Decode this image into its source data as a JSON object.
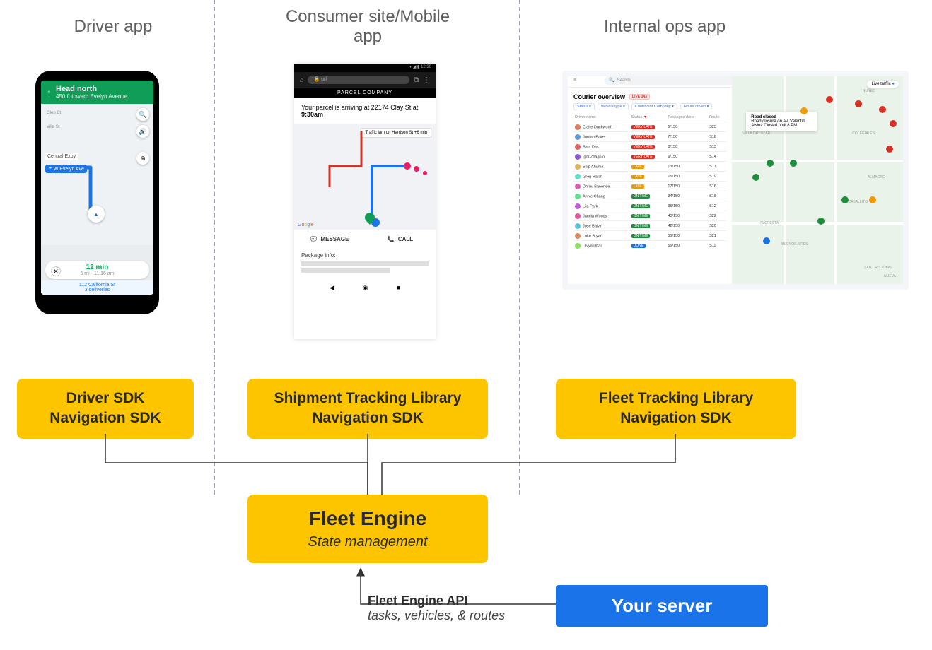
{
  "columns": {
    "driver": "Driver app",
    "consumer": "Consumer site/Mobile app",
    "ops": "Internal ops app"
  },
  "driver_mock": {
    "direction_title": "Head north",
    "direction_sub": "450 ft  toward Evelyn Avenue",
    "street_pill": "↱ W Evelyn Ave",
    "street_central": "Central Expy",
    "street_glen": "Glen Ct",
    "street_villa": "Villa St",
    "eta_time": "12 min",
    "eta_sub": "5 mi · 11:16 am",
    "footer_addr": "112 California St",
    "footer_deliveries": "3 deliveries"
  },
  "consumer_mock": {
    "status_time": "12:30",
    "url_placeholder": "url",
    "brand": "PARCEL COMPANY",
    "msg_body": "Your parcel is arriving at 22174 Clay St at",
    "msg_time": "9:30am",
    "jam": "Traffic jam on Harrison St +6 min",
    "google": "Google",
    "message_btn": "MESSAGE",
    "call_btn": "CALL",
    "pkg_info": "Package info:"
  },
  "ops_mock": {
    "search": "Search",
    "title": "Courier overview",
    "live_label": "LIVE 343",
    "filters": [
      "Status",
      "Vehicle type",
      "Contractor Company",
      "Hours driven"
    ],
    "th": {
      "name": "Driver name",
      "status": "Status",
      "pkg": "Packages done",
      "route": "Route"
    },
    "rows": [
      {
        "name": "Claire Duckworth",
        "status": "VERY LATE",
        "badge": "red",
        "pkg": "5/150",
        "route": "S23",
        "av": "#e07b5a"
      },
      {
        "name": "Jordan Baker",
        "status": "VERY LATE",
        "badge": "red",
        "pkg": "7/150",
        "route": "S18",
        "av": "#5a9ee0"
      },
      {
        "name": "Sam Das",
        "status": "VERY LATE",
        "badge": "red",
        "pkg": "8/150",
        "route": "S13",
        "av": "#e05a5a"
      },
      {
        "name": "Igor Zhagolo",
        "status": "VERY LATE",
        "badge": "red",
        "pkg": "9/150",
        "route": "S14",
        "av": "#8b5ae0"
      },
      {
        "name": "Skip Ahuma",
        "status": "LATE",
        "badge": "or",
        "pkg": "13/150",
        "route": "S17",
        "av": "#e0b15a"
      },
      {
        "name": "Greg Hatch",
        "status": "LATE",
        "badge": "or",
        "pkg": "15/150",
        "route": "S19",
        "av": "#5ae0c4"
      },
      {
        "name": "Dhruv Banerjee",
        "status": "LATE",
        "badge": "or",
        "pkg": "17/150",
        "route": "S16",
        "av": "#e05ab1"
      },
      {
        "name": "Annie Chang",
        "status": "ON TIME",
        "badge": "gr",
        "pkg": "34/150",
        "route": "S18",
        "av": "#5ae087"
      },
      {
        "name": "Lila Park",
        "status": "ON TIME",
        "badge": "gr",
        "pkg": "35/150",
        "route": "S12",
        "av": "#c45ae0"
      },
      {
        "name": "Jamila Woods",
        "status": "ON TIME",
        "badge": "gr",
        "pkg": "40/150",
        "route": "S22",
        "av": "#e05a9b"
      },
      {
        "name": "José Balvin",
        "status": "ON TIME",
        "badge": "gr",
        "pkg": "42/150",
        "route": "S20",
        "av": "#5ac4e0"
      },
      {
        "name": "Luke Bryan",
        "status": "ON TIME",
        "badge": "gr",
        "pkg": "55/150",
        "route": "S21",
        "av": "#e0875a"
      },
      {
        "name": "Divya Dhar",
        "status": "DONE",
        "badge": "bl",
        "pkg": "56/150",
        "route": "S11",
        "av": "#87e05a"
      }
    ],
    "live_traffic": "Live traffic",
    "toast_title": "Road closed",
    "toast_body": "Road closure on Av. Valentín Alsina Closed until 8 PM",
    "areas": [
      "NUÑEZ",
      "COLEGIALES",
      "VILLA ORTÚZAR",
      "ALMAGRO",
      "CABALLITO",
      "FLORESTA",
      "BUENOS AIRES",
      "SAN CRISTÓBAL",
      "NUEVA"
    ]
  },
  "sdk": {
    "driver_sdk": "Driver SDK\nNavigation SDK",
    "consumer_sdk": "Shipment Tracking Library\nNavigation SDK",
    "ops_sdk": "Fleet Tracking Library\nNavigation SDK"
  },
  "fleet": {
    "title": "Fleet Engine",
    "sub": "State management"
  },
  "server": {
    "label": "Your server"
  },
  "api": {
    "l1": "Fleet Engine API",
    "l2": "tasks, vehicles, & routes"
  }
}
